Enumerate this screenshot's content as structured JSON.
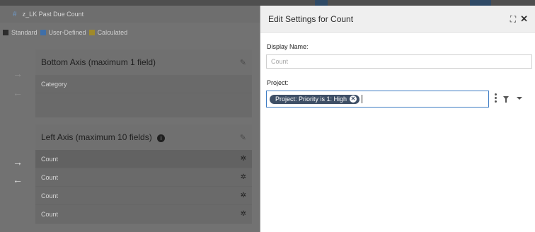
{
  "background": {
    "report_title": "z_LK Past Due Count",
    "legend": [
      {
        "label": "Standard",
        "color": "#2c2c2c"
      },
      {
        "label": "User-Defined",
        "color": "#3f6fa8"
      },
      {
        "label": "Calculated",
        "color": "#a08a2a"
      }
    ],
    "bottom_axis": {
      "title": "Bottom Axis (maximum 1 field)",
      "fields": [
        "Category"
      ]
    },
    "left_axis": {
      "title": "Left Axis (maximum 10 fields)",
      "fields": [
        "Count",
        "Count",
        "Count",
        "Count"
      ]
    }
  },
  "modal": {
    "title": "Edit Settings for Count",
    "icons": {
      "expand": "expand-icon",
      "close": "close-icon"
    },
    "display_name": {
      "label": "Display Name:",
      "placeholder": "Count"
    },
    "project": {
      "label": "Project:",
      "filter_chip": "Project: Priority is 1: High"
    }
  }
}
